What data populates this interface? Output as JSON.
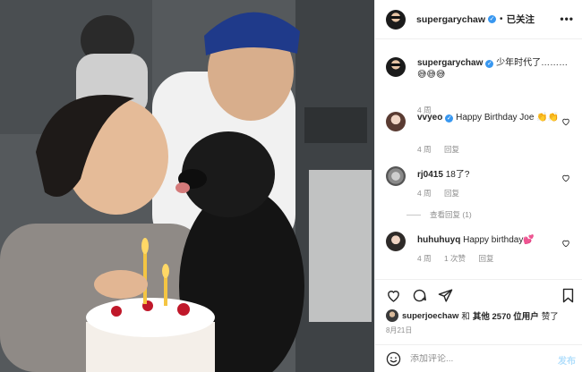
{
  "post": {
    "username": "supergarychaw",
    "follow_status": "已关注",
    "verified_glyph": "✓"
  },
  "caption": {
    "username": "supergarychaw",
    "text": "少年时代了………😅😅😅",
    "time": "4 周"
  },
  "comments": [
    {
      "username": "vvyeo",
      "verified": true,
      "text": "Happy Birthday Joe 👏👏",
      "time": "4 周",
      "reply": "回复"
    },
    {
      "username": "rj0415",
      "verified": false,
      "text": "18了?",
      "time": "4 周",
      "reply": "回复",
      "view_replies": "查看回复 (1)"
    },
    {
      "username": "huhuhuyq",
      "verified": false,
      "text": "Happy birthday💕",
      "time": "4 周",
      "likes": "1 次赞",
      "reply": "回复"
    }
  ],
  "likes": {
    "liker": "superjoechaw",
    "connector": "和",
    "others": "其他 2570 位用户",
    "suffix": "赞了"
  },
  "date": "8月21日",
  "compose": {
    "placeholder": "添加评论...",
    "post_label": "发布"
  },
  "colors": {
    "verified": "#3897f0",
    "secondary_text": "#8e8e8e",
    "post_button_disabled": "#b2dffc"
  },
  "icons": [
    "more-options-icon",
    "heart-icon",
    "comment-icon",
    "share-icon",
    "bookmark-icon",
    "emoji-icon",
    "verified-icon"
  ]
}
